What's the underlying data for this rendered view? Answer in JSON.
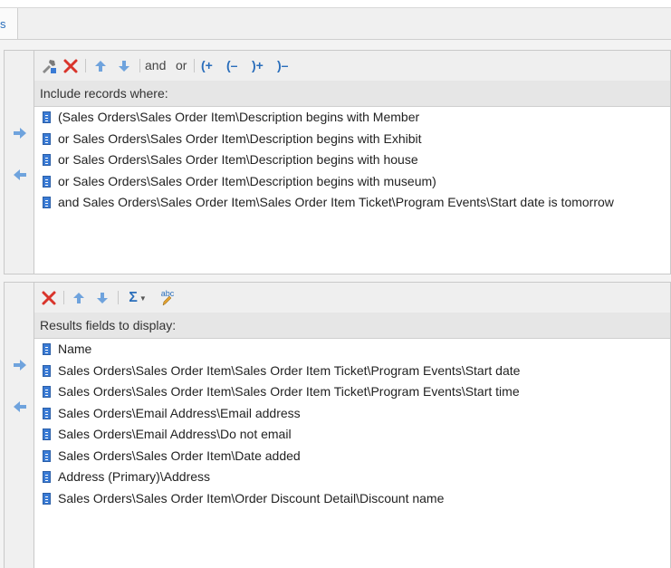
{
  "tab": {
    "label": "s"
  },
  "criteria": {
    "toolbar": {
      "and_label": "and",
      "or_label": "or",
      "open_paren": "(+",
      "close_open": "(–",
      "close_paren": ")+",
      "remove_paren": ")–"
    },
    "header": "Include records where:",
    "items": [
      "(Sales Orders\\Sales Order Item\\Description begins with Member",
      "or Sales Orders\\Sales Order Item\\Description begins with Exhibit",
      "or Sales Orders\\Sales Order Item\\Description begins with house",
      "or Sales Orders\\Sales Order Item\\Description begins with museum)",
      "and Sales Orders\\Sales Order Item\\Sales Order Item Ticket\\Program Events\\Start date is tomorrow"
    ]
  },
  "results": {
    "toolbar": {
      "sum_label": "Σ",
      "rename_label": "abc"
    },
    "header": "Results fields to display:",
    "items": [
      "Name",
      "Sales Orders\\Sales Order Item\\Sales Order Item Ticket\\Program Events\\Start date",
      "Sales Orders\\Sales Order Item\\Sales Order Item Ticket\\Program Events\\Start time",
      "Sales Orders\\Email Address\\Email address",
      "Sales Orders\\Email Address\\Do not email",
      "Sales Orders\\Sales Order Item\\Date added",
      "Address (Primary)\\Address",
      "Sales Orders\\Sales Order Item\\Order Discount Detail\\Discount name"
    ]
  },
  "colors": {
    "accent": "#2a6ebb",
    "delete": "#d9342b",
    "arrow": "#6fa3dd"
  }
}
